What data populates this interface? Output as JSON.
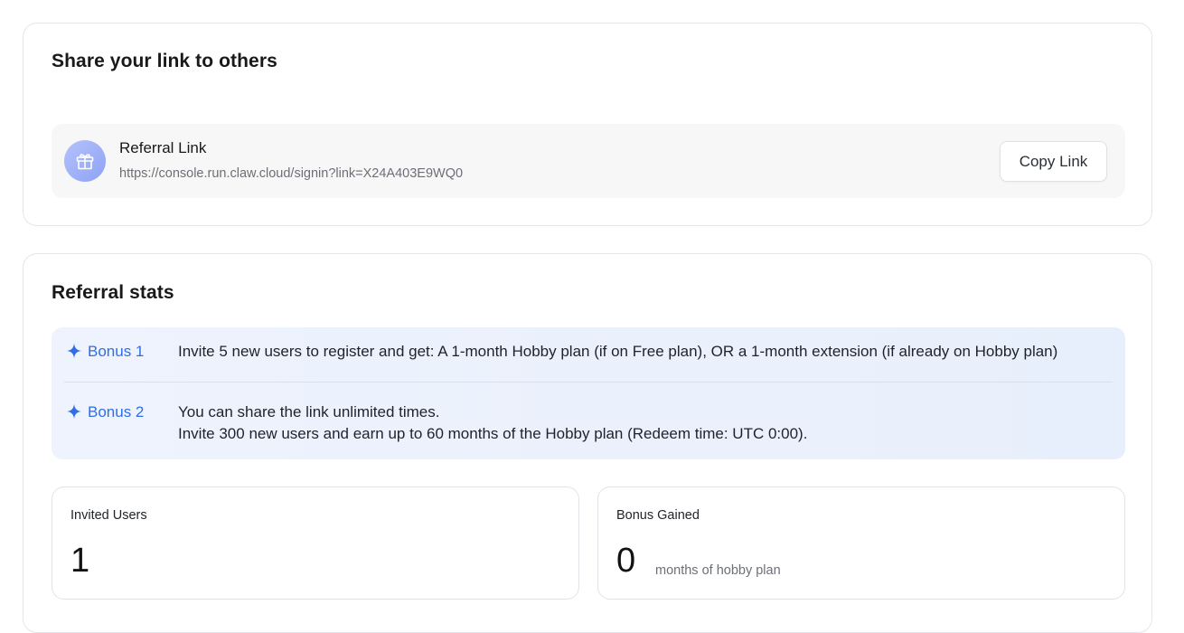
{
  "share": {
    "title": "Share your link to others",
    "link_label": "Referral Link",
    "link_url": "https://console.run.claw.cloud/signin?link=X24A403E9WQ0",
    "copy_button": "Copy Link"
  },
  "stats": {
    "title": "Referral stats",
    "bonuses": [
      {
        "name": "Bonus 1",
        "lines": [
          "Invite 5 new users to register and get: A 1-month Hobby plan (if on Free plan), OR a 1-month extension (if already on Hobby plan)"
        ]
      },
      {
        "name": "Bonus 2",
        "lines": [
          "You can share the link unlimited times.",
          "Invite 300 new users and earn up to 60 months of the Hobby plan (Redeem time: UTC 0:00)."
        ]
      }
    ],
    "invited_users": {
      "label": "Invited Users",
      "value": "1"
    },
    "bonus_gained": {
      "label": "Bonus Gained",
      "value": "0",
      "unit": "months of hobby plan"
    }
  },
  "icons": {
    "gift": "gift-icon",
    "sparkle": "sparkle-icon"
  },
  "colors": {
    "accent_blue": "#2f6ee8",
    "bonus_bg": "#eef3fd",
    "avatar_gradient_start": "#b4c2fb",
    "avatar_gradient_end": "#8ea2f5"
  }
}
